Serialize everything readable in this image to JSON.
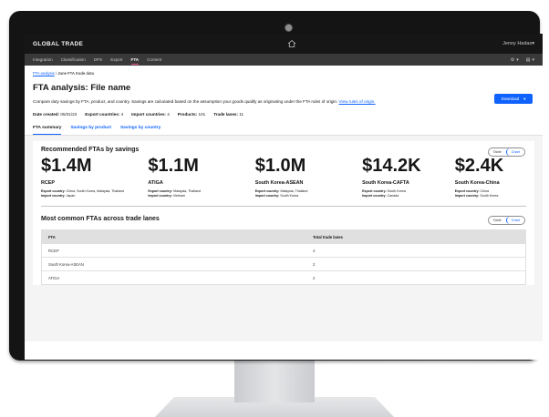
{
  "app": {
    "title": "GLOBAL TRADE",
    "user": "Jenny Hadas",
    "user_chevron": "▾"
  },
  "nav": {
    "items": [
      "Integration",
      "Classification",
      "DPS",
      "Export",
      "FTA",
      "Content"
    ],
    "active": "FTA",
    "tools": [
      {
        "icon": "settings-icon",
        "glyph": "⚙",
        "chevron": "▾"
      },
      {
        "icon": "apps-icon",
        "glyph": "▤",
        "chevron": "▾"
      }
    ]
  },
  "breadcrumb": {
    "link": "FTA analysis",
    "separator": "/",
    "current": "June FTA trade data"
  },
  "page": {
    "title": "FTA analysis: File name",
    "download_label": "Download",
    "download_chevron": "▾",
    "description": "Compare duty savings by FTA, product, and country. Savings are calculated based on the assumption your goods qualify as originating under the FTA rules of origin.",
    "description_link": "View rules of origin."
  },
  "meta": [
    {
      "label": "Date created:",
      "value": "05/31/22"
    },
    {
      "label": "Export countries:",
      "value": "4"
    },
    {
      "label": "Import countries:",
      "value": "4"
    },
    {
      "label": "Products:",
      "value": "101"
    },
    {
      "label": "Trade lanes:",
      "value": "11"
    }
  ],
  "tabs": [
    "FTA summary",
    "Savings by product",
    "Savings by country"
  ],
  "toggle": {
    "table": "Table",
    "chart": "Chart"
  },
  "recommended": {
    "title": "Recommended FTAs by savings",
    "export_label": "Export country:",
    "import_label": "Import country:",
    "items": [
      {
        "amount": "$1.4M",
        "name": "RCEP",
        "export": "China, South Korea, Malaysia, Thailand",
        "import": "Japan"
      },
      {
        "amount": "$1.1M",
        "name": "ATIGA",
        "export": "Malaysia, Thailand",
        "import": "Vietnam"
      },
      {
        "amount": "$1.0M",
        "name": "South Korea-ASEAN",
        "export": "Malaysia, Thailand",
        "import": "South Korea"
      },
      {
        "amount": "$14.2K",
        "name": "South Korea-CAFTA",
        "export": "South Korea",
        "import": "Canada"
      },
      {
        "amount": "$2.4K",
        "name": "South Korea-China",
        "export": "China",
        "import": "South Korea"
      }
    ]
  },
  "common": {
    "title": "Most common FTAs across trade lanes",
    "headers": [
      "FTA",
      "Total trade lanes"
    ],
    "rows": [
      [
        "RCEP",
        "4"
      ],
      [
        "South Korea-ASEAN",
        "2"
      ],
      [
        "ATIGA",
        "2"
      ]
    ]
  }
}
